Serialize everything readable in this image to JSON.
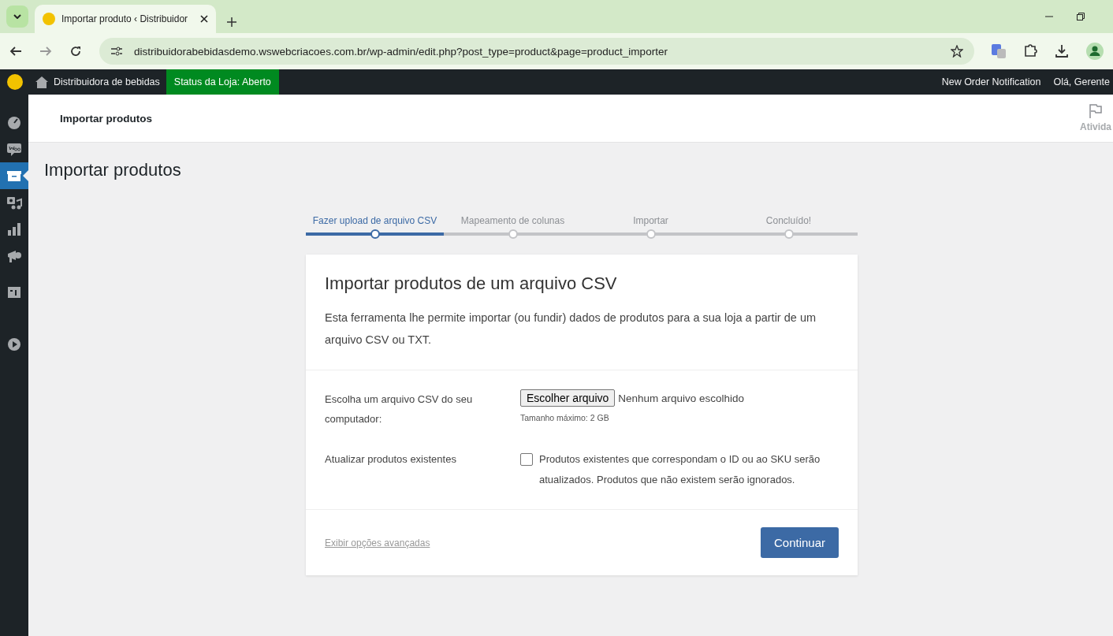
{
  "browser": {
    "tab_title": "Importar produto ‹ Distribuidor",
    "url": "distribuidorabebidasdemo.wswebcriacoes.com.br/wp-admin/edit.php?post_type=product&page=product_importer"
  },
  "admin_bar": {
    "site_name": "Distribuidora de bebidas",
    "store_status": "Status da Loja: Aberto",
    "right_items": [
      "New Order Notification",
      "Olá, Gerente"
    ]
  },
  "sidebar": {
    "items": [
      {
        "kind": "dashboard",
        "selected": false
      },
      {
        "kind": "woo",
        "selected": false
      },
      {
        "kind": "products",
        "selected": true
      },
      {
        "kind": "media",
        "selected": false
      },
      {
        "kind": "analytics",
        "selected": false
      },
      {
        "kind": "marketing",
        "selected": false
      },
      {
        "kind": "blocks",
        "selected": false
      },
      {
        "kind": "play",
        "selected": false
      }
    ]
  },
  "header": {
    "title": "Importar produtos",
    "activity": "Ativida"
  },
  "page_title": "Importar produtos",
  "steps": [
    {
      "label": "Fazer upload de arquivo CSV",
      "selected": true
    },
    {
      "label": "Mapeamento de colunas",
      "selected": false
    },
    {
      "label": "Importar",
      "selected": false
    },
    {
      "label": "Concluído!",
      "selected": false
    }
  ],
  "card": {
    "title": "Importar produtos de um arquivo CSV",
    "description": "Esta ferramenta lhe permite importar (ou fundir) dados de produtos para a sua loja a partir de um arquivo CSV ou TXT.",
    "file_label": "Escolha um arquivo CSV do seu computador:",
    "file_button": "Escolher arquivo",
    "file_status": "Nenhum arquivo escolhido",
    "file_hint": "Tamanho máximo: 2 GB",
    "update_label": "Atualizar produtos existentes",
    "update_checked": false,
    "update_text": "Produtos existentes que correspondam o ID ou ao SKU serão atualizados. Produtos que não existem serão ignorados.",
    "advanced_link": "Exibir opções avançadas",
    "continue_button": "Continuar"
  }
}
